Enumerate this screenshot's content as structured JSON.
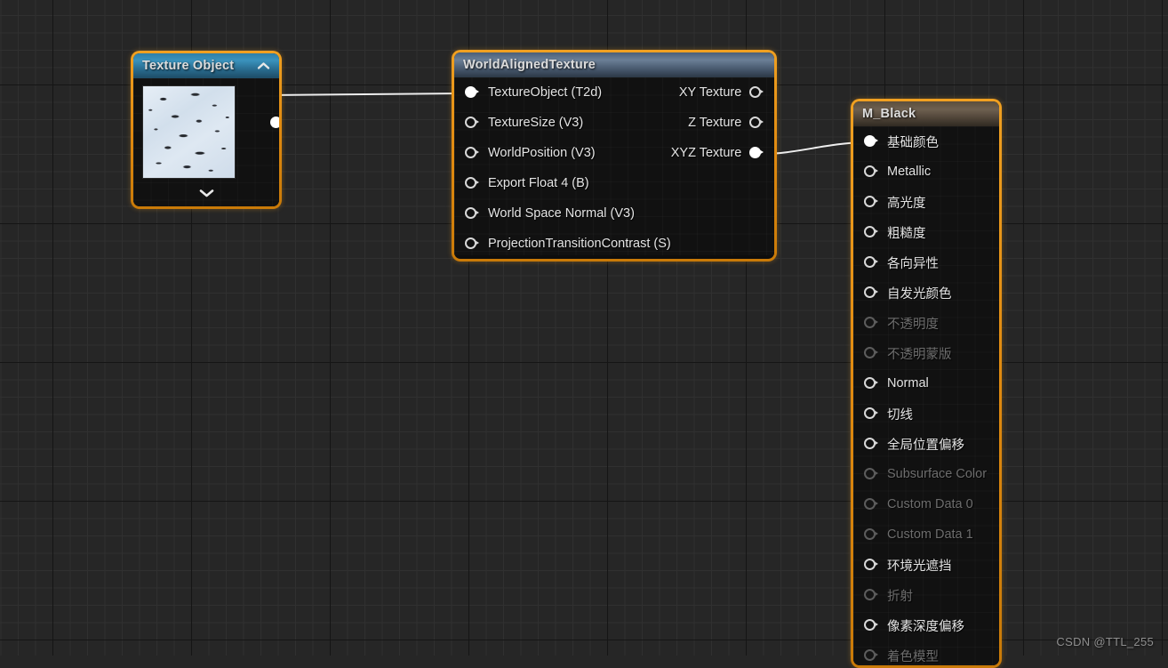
{
  "watermark": "CSDN @TTL_255",
  "colors": {
    "selection_orange": "#f0a021",
    "canvas_bg": "#262626",
    "grid_minor": "#303030",
    "grid_major": "#151515",
    "wire": "#ffffff",
    "pin_connected": "#ffffff",
    "pin_empty": "#d8d8d8",
    "pin_disabled": "#5c5c5c",
    "label": "#e4e4e4",
    "label_disabled": "#6d6d6d"
  },
  "nodes": {
    "texture_object": {
      "title": "Texture Object",
      "collapse_icon": "chevron-up-icon",
      "expand_icon": "chevron-down-icon",
      "thumbnail_name": "texture-preview-thumbnail",
      "output_pin": {
        "label": "",
        "connected": true
      }
    },
    "world_aligned_texture": {
      "title": "WorldAlignedTexture",
      "inputs": [
        {
          "label": "TextureObject (T2d)",
          "connected": true,
          "enabled": true
        },
        {
          "label": "TextureSize (V3)",
          "connected": false,
          "enabled": true
        },
        {
          "label": "WorldPosition (V3)",
          "connected": false,
          "enabled": true
        },
        {
          "label": "Export Float 4 (B)",
          "connected": false,
          "enabled": true
        },
        {
          "label": "World Space Normal (V3)",
          "connected": false,
          "enabled": true
        },
        {
          "label": "ProjectionTransitionContrast (S)",
          "connected": false,
          "enabled": true
        }
      ],
      "outputs": [
        {
          "label": "XY Texture",
          "connected": false,
          "enabled": true
        },
        {
          "label": "Z Texture",
          "connected": false,
          "enabled": true
        },
        {
          "label": "XYZ Texture",
          "connected": true,
          "enabled": true
        }
      ]
    },
    "m_black": {
      "title": "M_Black",
      "inputs": [
        {
          "label": "基础颜色",
          "connected": true,
          "enabled": true
        },
        {
          "label": "Metallic",
          "connected": false,
          "enabled": true
        },
        {
          "label": "高光度",
          "connected": false,
          "enabled": true
        },
        {
          "label": "粗糙度",
          "connected": false,
          "enabled": true
        },
        {
          "label": "各向异性",
          "connected": false,
          "enabled": true
        },
        {
          "label": "自发光颜色",
          "connected": false,
          "enabled": true
        },
        {
          "label": "不透明度",
          "connected": false,
          "enabled": false
        },
        {
          "label": "不透明蒙版",
          "connected": false,
          "enabled": false
        },
        {
          "label": "Normal",
          "connected": false,
          "enabled": true
        },
        {
          "label": "切线",
          "connected": false,
          "enabled": true
        },
        {
          "label": "全局位置偏移",
          "connected": false,
          "enabled": true
        },
        {
          "label": "Subsurface Color",
          "connected": false,
          "enabled": false
        },
        {
          "label": "Custom Data 0",
          "connected": false,
          "enabled": false
        },
        {
          "label": "Custom Data 1",
          "connected": false,
          "enabled": false
        },
        {
          "label": "环境光遮挡",
          "connected": false,
          "enabled": true
        },
        {
          "label": "折射",
          "connected": false,
          "enabled": false
        },
        {
          "label": "像素深度偏移",
          "connected": false,
          "enabled": true
        },
        {
          "label": "着色模型",
          "connected": false,
          "enabled": false
        }
      ]
    }
  },
  "wires": [
    {
      "from": "texture-object-output",
      "to": "worldalignedtexture-textureobject-input"
    },
    {
      "from": "worldalignedtexture-xyz-output",
      "to": "m-black-base-color-input"
    }
  ]
}
